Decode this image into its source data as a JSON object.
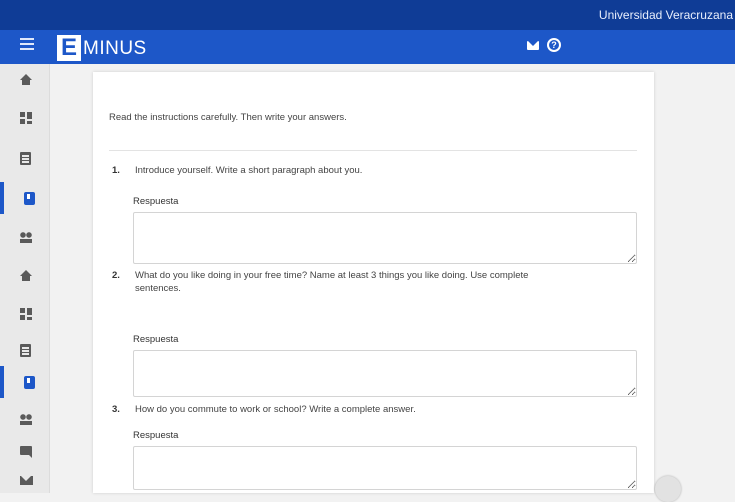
{
  "topbar": {
    "institution": "Universidad Veracruzana"
  },
  "header": {
    "logo_letter": "E",
    "logo_text": "MINUS",
    "menu_icon": "menu-icon",
    "mail_icon": "mail-icon",
    "help_icon": "help-icon",
    "help_glyph": "?"
  },
  "sidebar": {
    "items": [
      {
        "icon": "home-icon"
      },
      {
        "icon": "dashboard-icon"
      },
      {
        "icon": "assignment-icon"
      },
      {
        "icon": "book-icon",
        "active": true
      },
      {
        "icon": "people-icon"
      },
      {
        "icon": "home-icon"
      },
      {
        "icon": "dashboard-icon"
      },
      {
        "icon": "assignment-icon"
      },
      {
        "icon": "book-icon",
        "active": true
      },
      {
        "icon": "people-icon"
      },
      {
        "icon": "chat-icon"
      },
      {
        "icon": "mail-icon"
      }
    ]
  },
  "exam": {
    "instructions": "Read the instructions carefully. Then write your answers.",
    "questions": [
      {
        "number": "1.",
        "text": "Introduce yourself. Write a short paragraph about you.",
        "answer_label": "Respuesta",
        "answer_value": ""
      },
      {
        "number": "2.",
        "text": "What do you like doing in your free time? Name at least 3 things you like doing. Use complete sentences.",
        "answer_label": "Respuesta",
        "answer_value": ""
      },
      {
        "number": "3.",
        "text": "How do you commute to work or school? Write a complete answer.",
        "answer_label": "Respuesta",
        "answer_value": ""
      }
    ]
  },
  "colors": {
    "primary": "#1d57c8",
    "topbar": "#0f3c96",
    "background": "#f2f2f2"
  }
}
